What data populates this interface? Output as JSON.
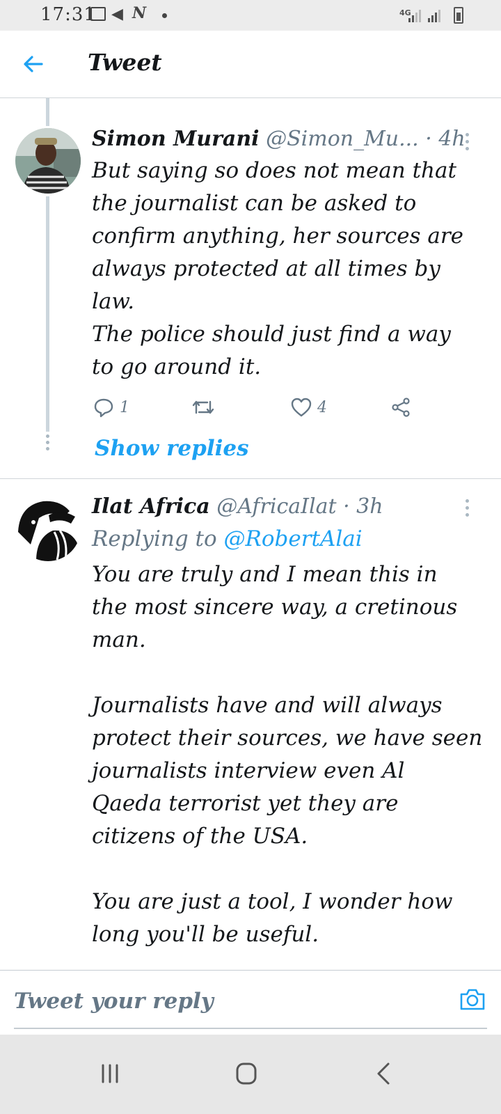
{
  "status_bar": {
    "time": "17:31",
    "network": "4G",
    "icons": [
      "gallery-icon",
      "telegram-icon",
      "n-app-icon",
      "notification-dot",
      "signal-icon",
      "signal-icon",
      "battery-icon"
    ]
  },
  "header": {
    "title": "Tweet",
    "back_icon": "arrow-left-icon"
  },
  "tweets": [
    {
      "name": "Simon Murani",
      "handle": "@Simon_Mu...",
      "time": "· 4h",
      "body": "But saying so does not mean that\nthe journalist can be asked to\nconfirm anything, her sources are\nalways protected at all times by\nlaw.\nThe police should just find a way\nto go around it.",
      "reply_count": "1",
      "retweet_count": "",
      "like_count": "4"
    },
    {
      "name": "Ilat Africa",
      "handle": "@AfricaIlat",
      "time": "· 3h",
      "replying_prefix": "Replying to",
      "replying_to": "@RobertAlai",
      "body": "You are truly and I mean this in\nthe most sincere way, a cretinous\nman.\n\nJournalists have and will always\nprotect their sources, we have seen\njournalists interview even Al\nQaeda terrorist yet they are\ncitizens of the USA.\n\nYou are just a tool, I wonder how\nlong you'll be useful."
    }
  ],
  "show_replies_label": "Show replies",
  "reply_bar": {
    "placeholder": "Tweet your reply"
  },
  "colors": {
    "accent": "#1da1f2",
    "text": "#14171a",
    "muted": "#657786",
    "divider": "#d0d5d9"
  }
}
